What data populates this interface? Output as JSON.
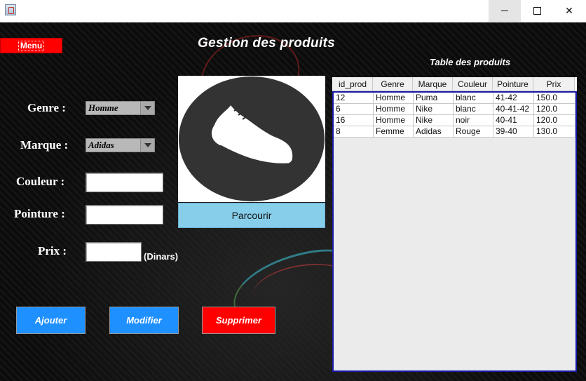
{
  "window": {
    "buttons": {
      "minimize": "minimize-icon",
      "maximize": "maximize-icon",
      "close": "close-icon"
    }
  },
  "header": {
    "menu_label": "Menu",
    "title": "Gestion des produits"
  },
  "form": {
    "genre": {
      "label": "Genre :",
      "value": "Homme"
    },
    "marque": {
      "label": "Marque :",
      "value": "Adidas"
    },
    "couleur": {
      "label": "Couleur :",
      "value": ""
    },
    "pointure": {
      "label": "Pointure :",
      "value": ""
    },
    "prix": {
      "label": "Prix :",
      "value": "",
      "unit": "(Dinars)"
    }
  },
  "image_panel": {
    "icon": "sneaker-icon",
    "browse_label": "Parcourir"
  },
  "actions": {
    "add": {
      "label": "Ajouter",
      "color": "#1e90ff"
    },
    "edit": {
      "label": "Modifier",
      "color": "#1e90ff"
    },
    "delete": {
      "label": "Supprimer",
      "color": "#ff0000"
    }
  },
  "table": {
    "caption": "Table des produits",
    "columns": [
      "id_prod",
      "Genre",
      "Marque",
      "Couleur",
      "Pointure",
      "Prix"
    ],
    "rows": [
      [
        "12",
        "Homme",
        "Puma",
        "blanc",
        "41-42",
        "150.0"
      ],
      [
        "6",
        "Homme",
        "Nike",
        "blanc",
        "40-41-42",
        "120.0"
      ],
      [
        "16",
        "Homme",
        "Nike",
        "noir",
        "40-41",
        "120.0"
      ],
      [
        "8",
        "Femme",
        "Adidas",
        "Rouge",
        "39-40",
        "130.0"
      ]
    ]
  },
  "colors": {
    "accent_red": "#ff0000",
    "accent_blue": "#1e90ff",
    "browse_button": "#87ceeb",
    "table_border": "#1a1aa8"
  }
}
